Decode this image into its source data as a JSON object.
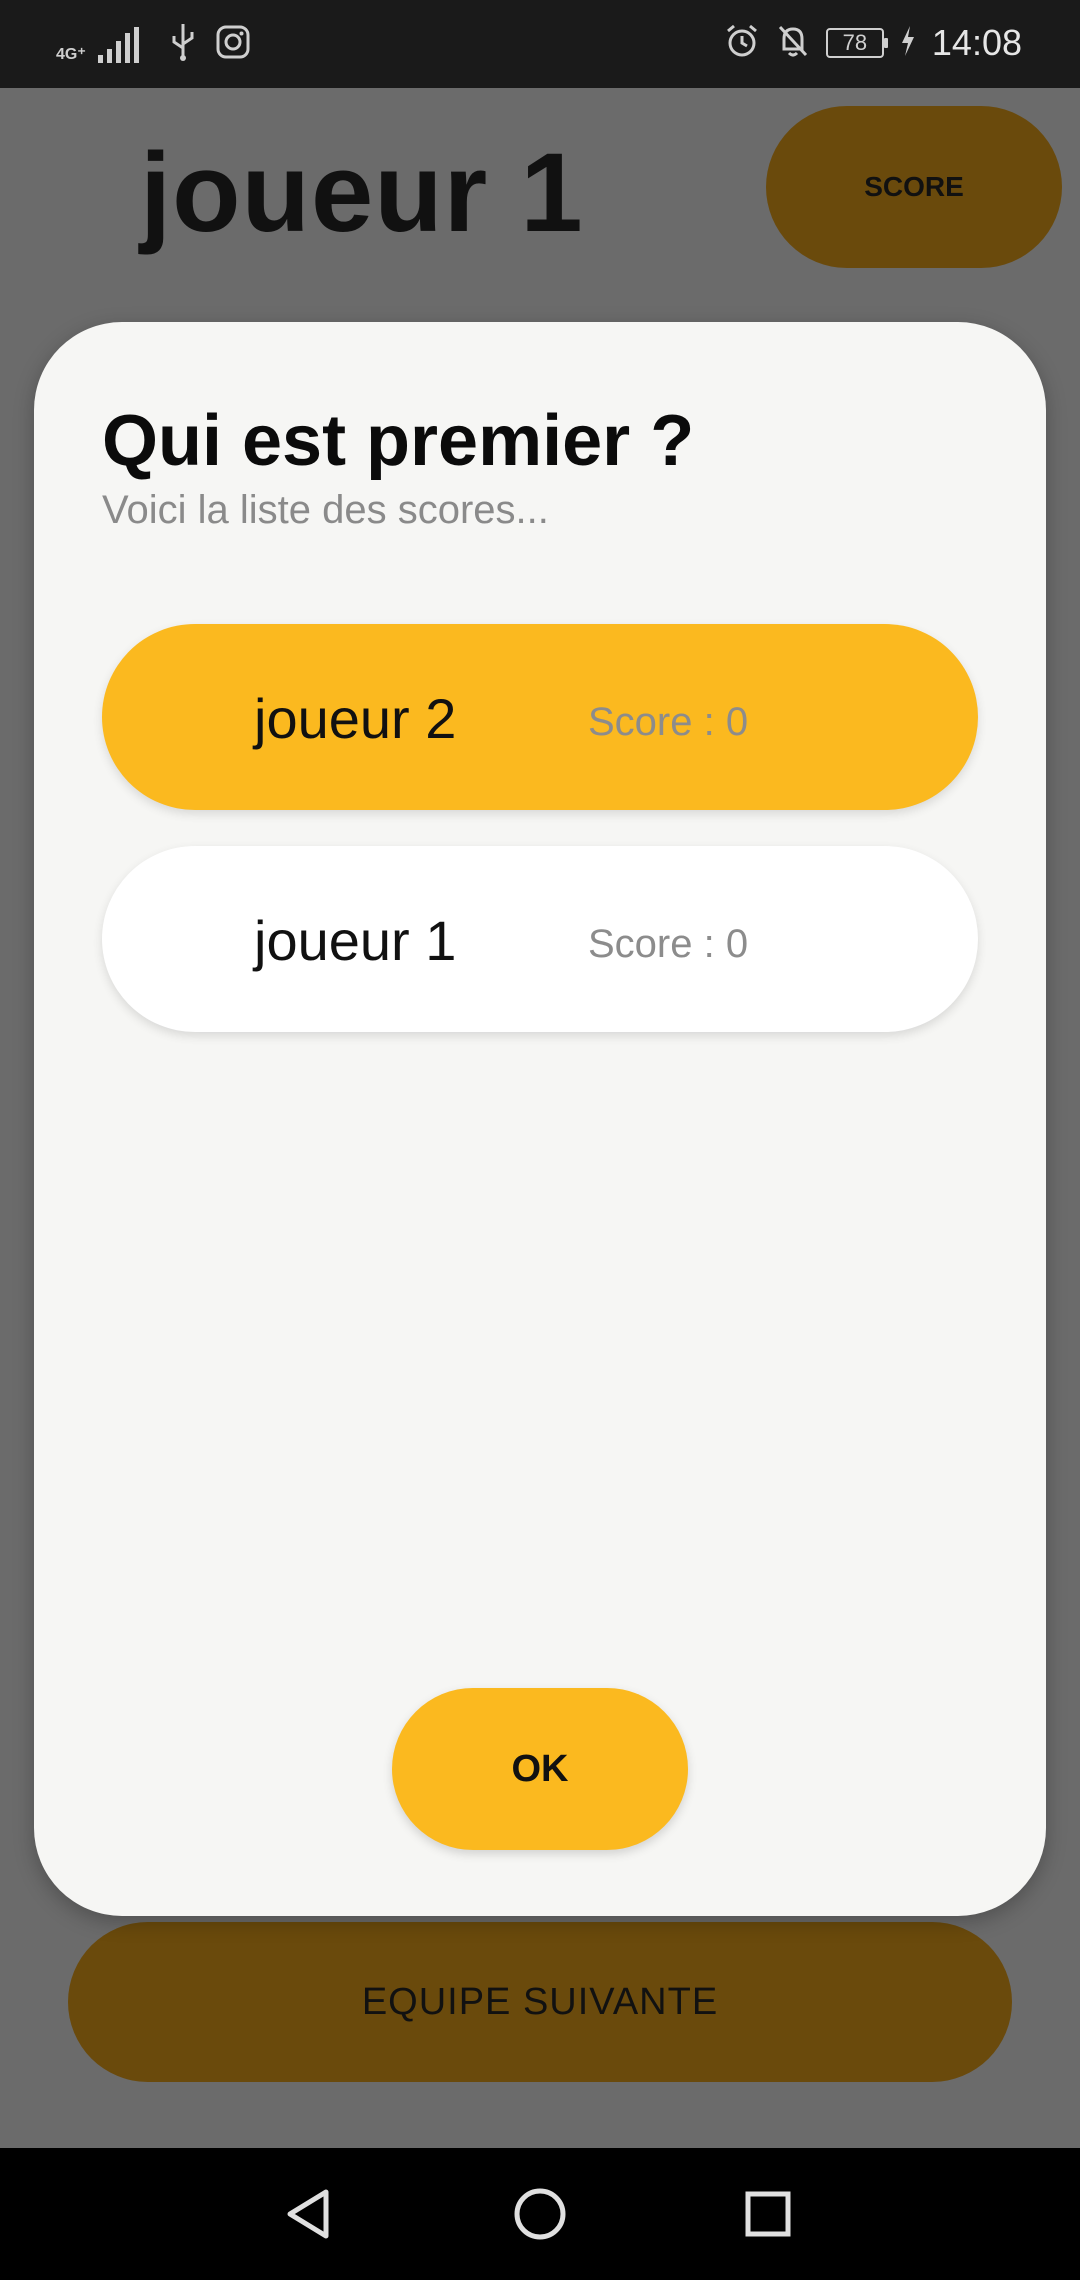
{
  "status_bar": {
    "network": "4G⁺",
    "battery": "78",
    "time": "14:08",
    "icons": [
      "signal-icon",
      "usb-icon",
      "instagram-icon",
      "alarm-icon",
      "notifications-off-icon",
      "battery-icon",
      "charging-icon"
    ]
  },
  "app": {
    "current_player": "joueur 1",
    "score_button": "SCORE",
    "next_team_button": "EQUIPE SUIVANTE",
    "accent_color": "#fbb91f",
    "dimmed_accent_color": "#6a4a0c"
  },
  "dialog": {
    "title": "Qui est premier ?",
    "subtitle": "Voici la liste des scores...",
    "rows": [
      {
        "name": "joueur 2",
        "score": "Score : 0",
        "highlighted": true
      },
      {
        "name": "joueur 1",
        "score": "Score : 0",
        "highlighted": false
      }
    ],
    "ok_button": "OK"
  },
  "nav_bar": {
    "buttons": [
      "back-icon",
      "home-icon",
      "recents-icon"
    ]
  }
}
